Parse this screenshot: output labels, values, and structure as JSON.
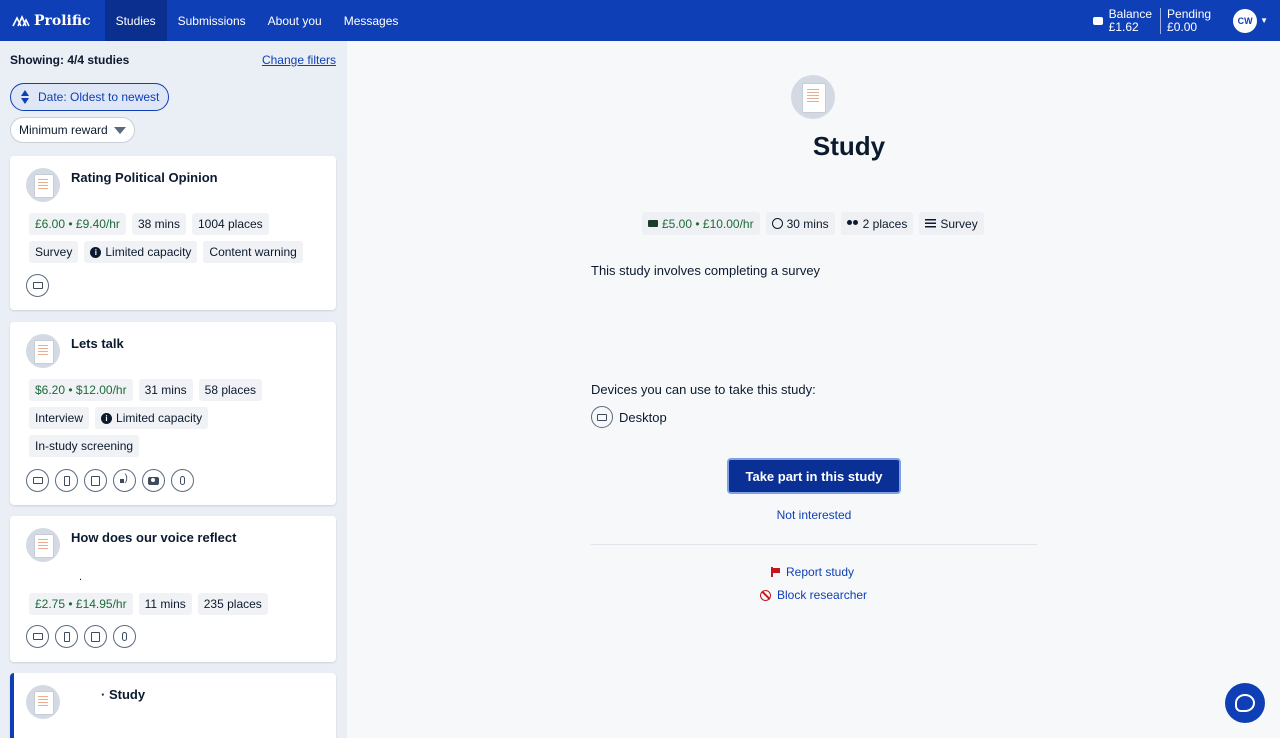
{
  "nav": {
    "brand": "Prolific",
    "items": [
      {
        "label": "Studies",
        "active": true
      },
      {
        "label": "Submissions",
        "active": false
      },
      {
        "label": "About you",
        "active": false
      },
      {
        "label": "Messages",
        "active": false
      }
    ],
    "balance_label": "Balance",
    "balance_value": "£1.62",
    "pending_label": "Pending",
    "pending_value": "£0.00",
    "avatar_initials": "CW"
  },
  "sidebar": {
    "showing": "Showing: 4/4 studies",
    "change_filters": "Change filters",
    "sort_label": "Date: Oldest to newest",
    "reward_filter": "Minimum reward",
    "studies": [
      {
        "title": "Rating Political Opinion",
        "reward": "£6.00 • £9.40/hr",
        "duration": "38 mins",
        "places": "1004 places",
        "tags": [
          "Survey",
          "Limited capacity",
          "Content warning"
        ],
        "devices": [
          "desktop-icon"
        ]
      },
      {
        "title": "Lets talk",
        "reward": "$6.20 • $12.00/hr",
        "duration": "31 mins",
        "places": "58 places",
        "tags": [
          "Interview",
          "Limited capacity",
          "In-study screening"
        ],
        "devices": [
          "desktop-icon",
          "phone-icon",
          "tablet-icon",
          "audio-icon",
          "camera-icon",
          "microphone-icon"
        ]
      },
      {
        "title": "How does our voice reflect",
        "subtitle_mark": ".",
        "reward": "£2.75 • £14.95/hr",
        "duration": "11 mins",
        "places": "235 places",
        "devices": [
          "desktop-icon",
          "phone-icon",
          "tablet-icon",
          "microphone-icon"
        ]
      },
      {
        "title_prefix": "·",
        "title": "Study"
      }
    ]
  },
  "main": {
    "title": "Study",
    "reward": "£5.00 • £10.00/hr",
    "duration": "30 mins",
    "places": "2 places",
    "type": "Survey",
    "description": "This study involves completing a survey",
    "devices_label": "Devices you can use to take this study:",
    "device": "Desktop",
    "take_part": "Take part in this study",
    "not_interested": "Not interested",
    "report": "Report study",
    "block": "Block researcher"
  },
  "colors": {
    "brand_blue": "#0f3fb6",
    "money_green": "#1d6b39",
    "danger_red": "#c4161c"
  }
}
